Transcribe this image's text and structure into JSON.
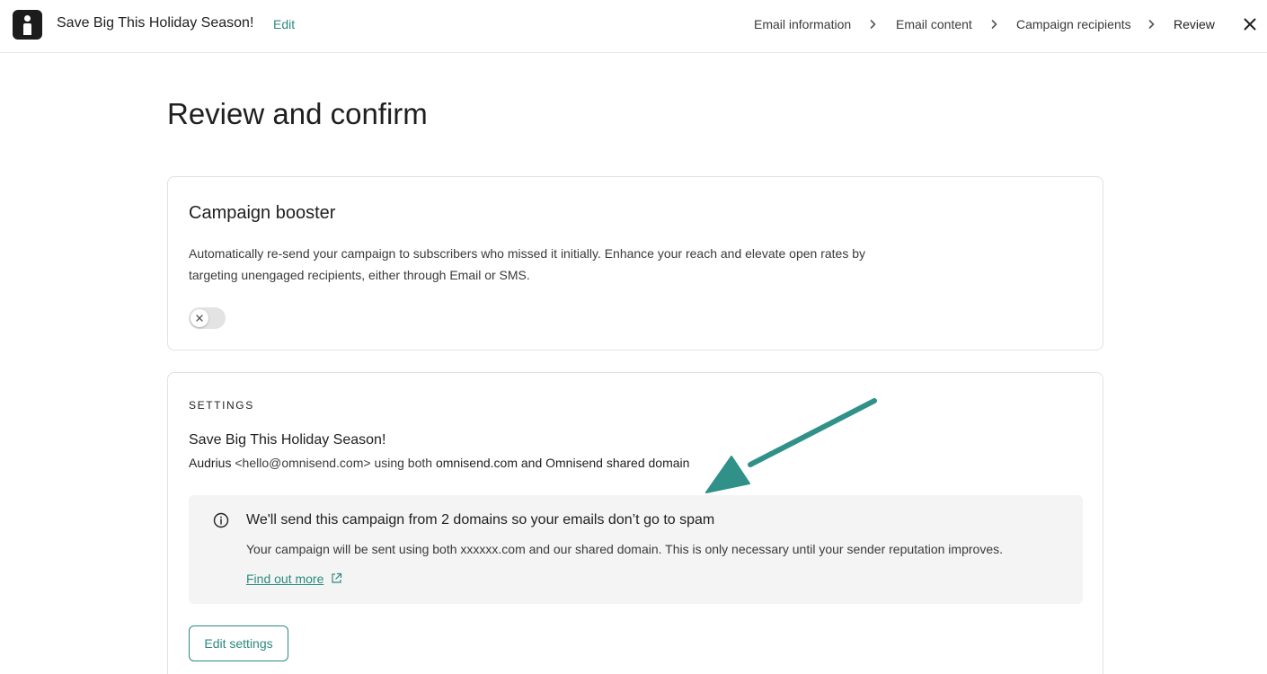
{
  "header": {
    "campaign_title": "Save Big This Holiday Season!",
    "edit_label": "Edit",
    "breadcrumbs": [
      {
        "label": "Email information"
      },
      {
        "label": "Email content"
      },
      {
        "label": "Campaign recipients"
      },
      {
        "label": "Review"
      }
    ],
    "close_icon": "close-icon"
  },
  "page": {
    "title": "Review and confirm"
  },
  "booster": {
    "title": "Campaign booster",
    "description": "Automatically re-send your campaign to subscribers who missed it initially. Enhance your reach and elevate open rates by targeting unengaged recipients, either through Email or SMS.",
    "toggle_on": false
  },
  "settings": {
    "section_label": "SETTINGS",
    "subject": "Save Big This Holiday Season!",
    "sender_name": "Audrius",
    "sender_email": "<hello@omnisend.com>",
    "sender_middle": "using both",
    "sender_domains": "omnisend.com and Omnisend shared domain",
    "notice": {
      "title": "We'll send this campaign from 2 domains so your emails don’t go to spam",
      "body": "Your campaign will be sent using both xxxxxx.com and our shared domain. This is only necessary until your sender reputation improves.",
      "link_label": "Find out more"
    },
    "edit_button_label": "Edit settings"
  },
  "colors": {
    "accent": "#2b8a80",
    "arrow": "#2f9188",
    "notice_bg": "#f4f4f4",
    "border": "#e2e2e2"
  }
}
